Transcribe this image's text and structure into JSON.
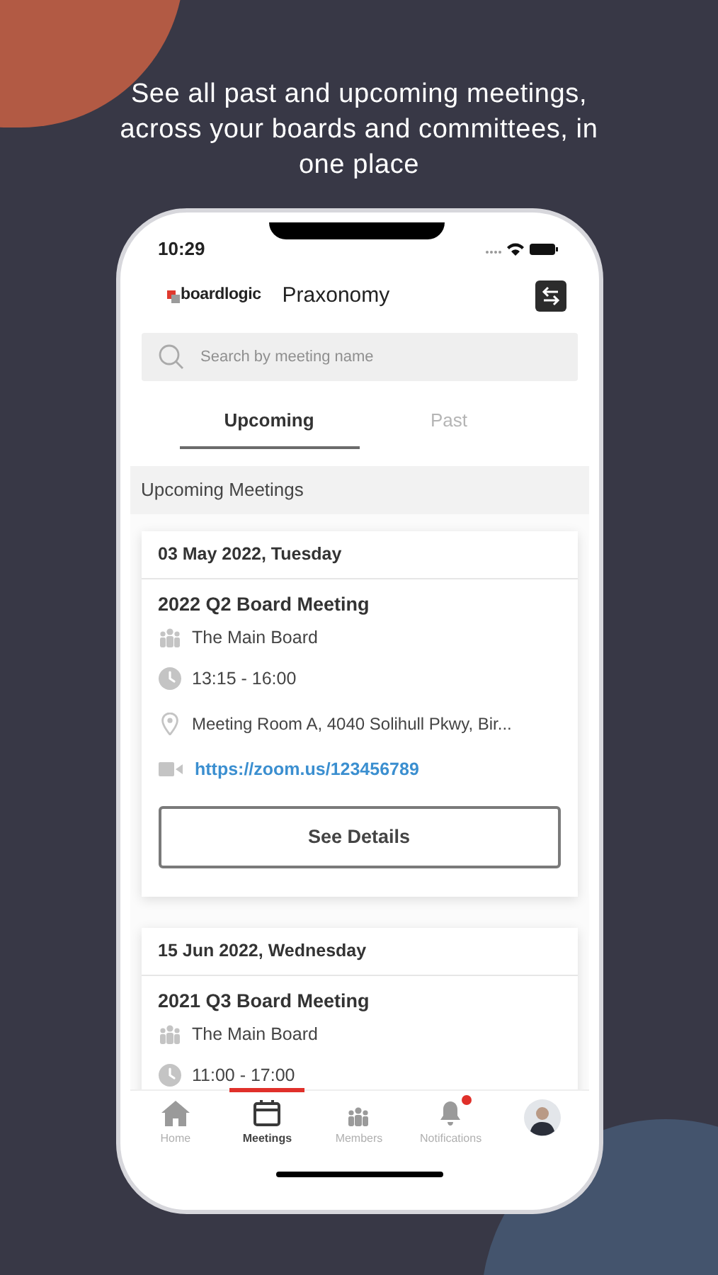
{
  "headline": "See all past and upcoming meetings, across your boards and committees, in one place",
  "status_bar": {
    "time": "10:29"
  },
  "header": {
    "logo": "boardlogic",
    "title": "Praxonomy"
  },
  "search": {
    "placeholder": "Search by meeting name"
  },
  "tabs": [
    {
      "label": "Upcoming",
      "selected": true
    },
    {
      "label": "Past",
      "selected": false
    }
  ],
  "section_title": "Upcoming Meetings",
  "meetings": [
    {
      "date": "03 May 2022, Tuesday",
      "title": "2022 Q2 Board Meeting",
      "board": "The Main Board",
      "time": "13:15 - 16:00",
      "location": "Meeting Room A, 4040 Solihull Pkwy, Bir...",
      "link": "https://zoom.us/123456789",
      "button": "See Details"
    },
    {
      "date": "15 Jun 2022, Wednesday",
      "title": "2021 Q3 Board Meeting",
      "board": "The Main Board",
      "time": "11:00 - 17:00"
    }
  ],
  "nav": [
    {
      "kind": "home",
      "label": "Home",
      "selected": false,
      "unread": false
    },
    {
      "kind": "meetings",
      "label": "Meetings",
      "selected": true,
      "unread": false
    },
    {
      "kind": "members",
      "label": "Members",
      "selected": false,
      "unread": false
    },
    {
      "kind": "notifications",
      "label": "Notifications",
      "selected": false,
      "unread": true
    },
    {
      "kind": "avatar",
      "selected": false
    }
  ]
}
